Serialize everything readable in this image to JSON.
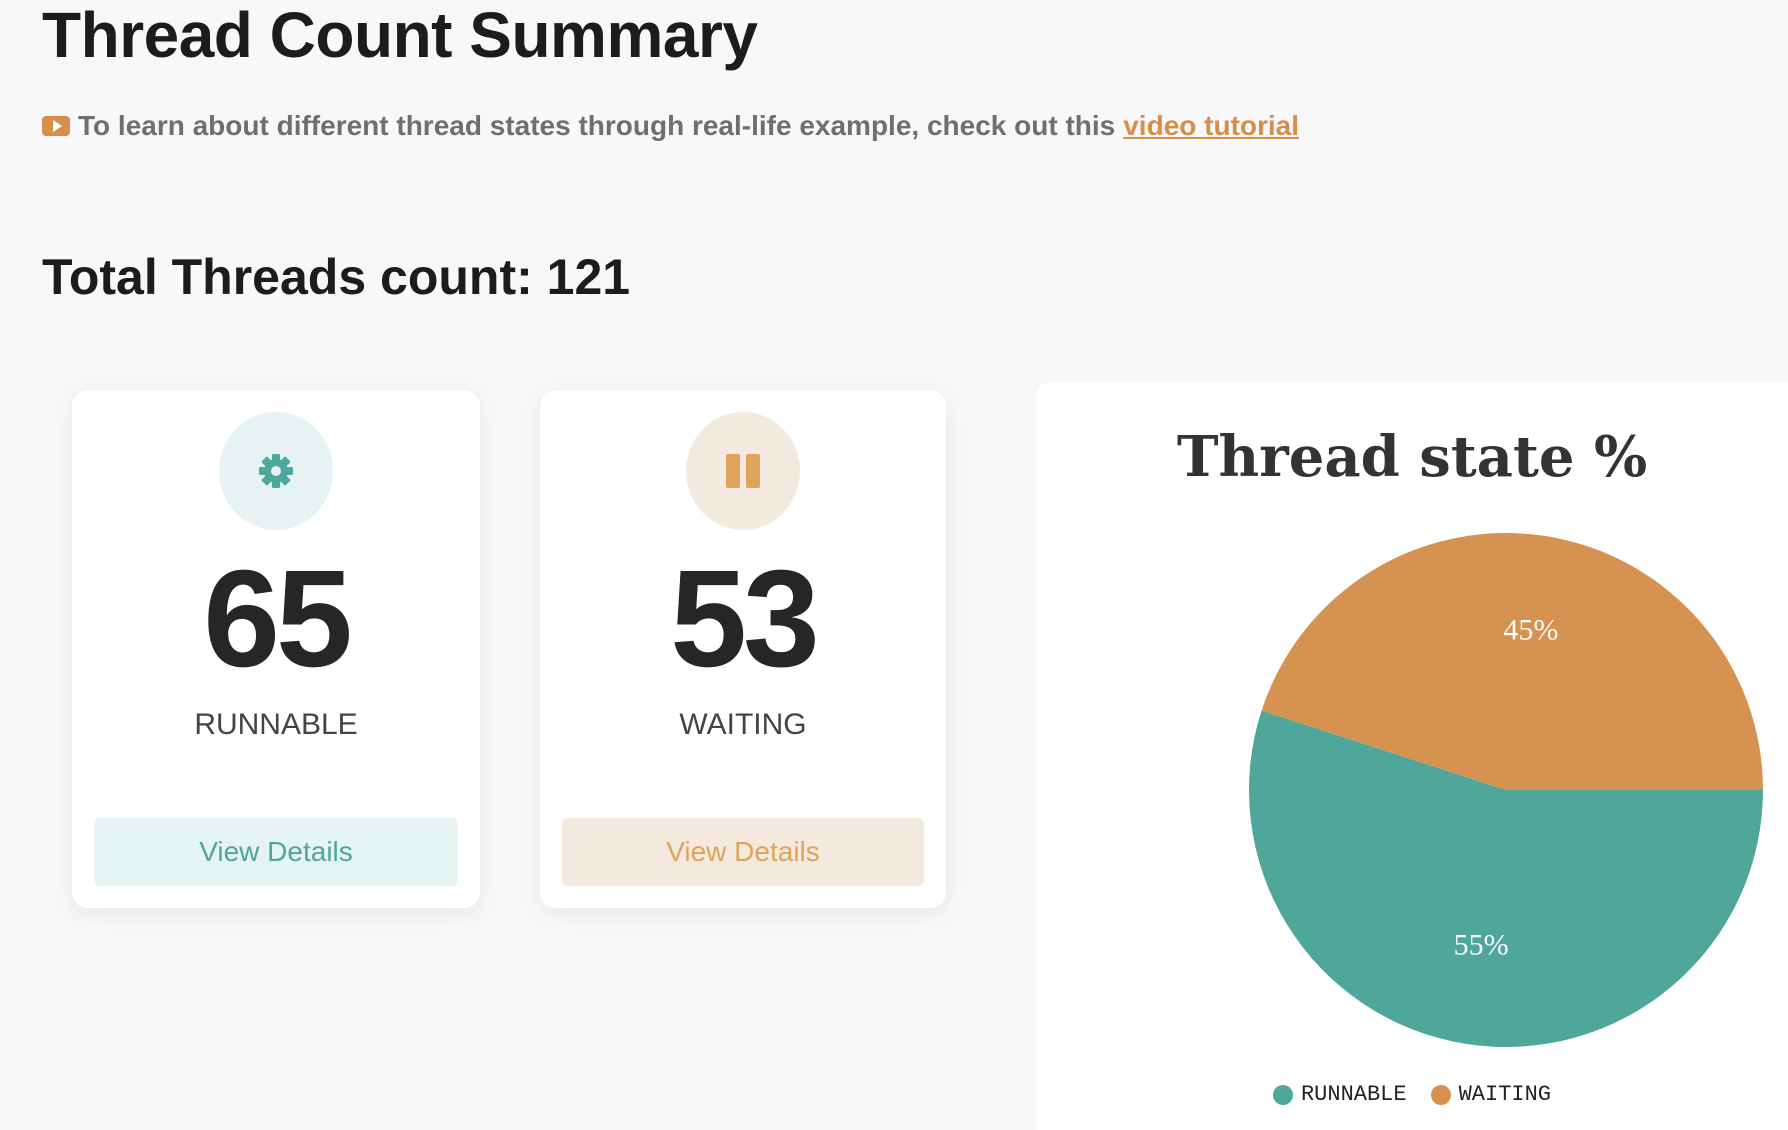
{
  "header": {
    "title": "Thread Count Summary",
    "tutorial_text": "To learn about different thread states through real-life example, check out this",
    "tutorial_link": "video tutorial"
  },
  "summary": {
    "total_label": "Total Threads count: 121"
  },
  "cards": [
    {
      "icon": "gear-icon",
      "value": "65",
      "label": "RUNNABLE",
      "button": "View Details",
      "color": "#4ea79b"
    },
    {
      "icon": "pause-icon",
      "value": "53",
      "label": "WAITING",
      "button": "View Details",
      "color": "#e0a35a"
    }
  ],
  "chart_data": {
    "type": "pie",
    "title": "Thread state %",
    "slices": [
      {
        "name": "RUNNABLE",
        "value": 55,
        "label": "55%",
        "color": "#4fa69a"
      },
      {
        "name": "WAITING",
        "value": 45,
        "label": "45%",
        "color": "#d69250"
      }
    ],
    "legend_position": "bottom"
  }
}
